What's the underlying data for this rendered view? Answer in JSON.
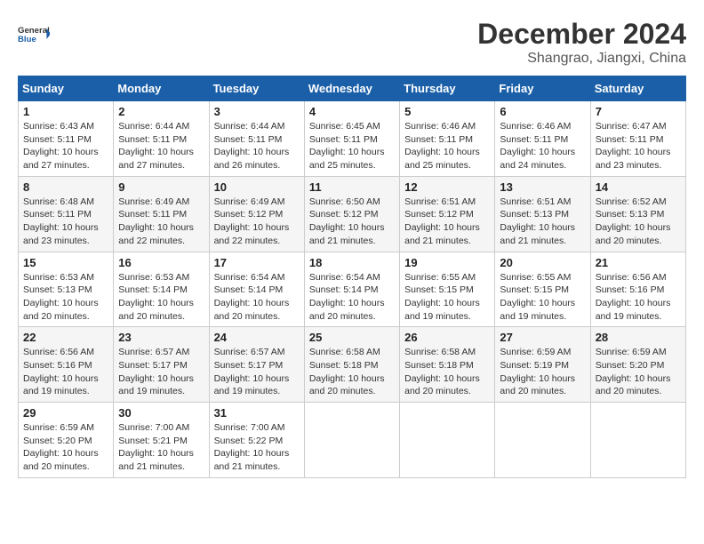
{
  "logo": {
    "line1": "General",
    "line2": "Blue"
  },
  "title": "December 2024",
  "location": "Shangrao, Jiangxi, China",
  "days_header": [
    "Sunday",
    "Monday",
    "Tuesday",
    "Wednesday",
    "Thursday",
    "Friday",
    "Saturday"
  ],
  "weeks": [
    [
      {
        "num": "1",
        "info": "Sunrise: 6:43 AM\nSunset: 5:11 PM\nDaylight: 10 hours\nand 27 minutes."
      },
      {
        "num": "2",
        "info": "Sunrise: 6:44 AM\nSunset: 5:11 PM\nDaylight: 10 hours\nand 27 minutes."
      },
      {
        "num": "3",
        "info": "Sunrise: 6:44 AM\nSunset: 5:11 PM\nDaylight: 10 hours\nand 26 minutes."
      },
      {
        "num": "4",
        "info": "Sunrise: 6:45 AM\nSunset: 5:11 PM\nDaylight: 10 hours\nand 25 minutes."
      },
      {
        "num": "5",
        "info": "Sunrise: 6:46 AM\nSunset: 5:11 PM\nDaylight: 10 hours\nand 25 minutes."
      },
      {
        "num": "6",
        "info": "Sunrise: 6:46 AM\nSunset: 5:11 PM\nDaylight: 10 hours\nand 24 minutes."
      },
      {
        "num": "7",
        "info": "Sunrise: 6:47 AM\nSunset: 5:11 PM\nDaylight: 10 hours\nand 23 minutes."
      }
    ],
    [
      {
        "num": "8",
        "info": "Sunrise: 6:48 AM\nSunset: 5:11 PM\nDaylight: 10 hours\nand 23 minutes."
      },
      {
        "num": "9",
        "info": "Sunrise: 6:49 AM\nSunset: 5:11 PM\nDaylight: 10 hours\nand 22 minutes."
      },
      {
        "num": "10",
        "info": "Sunrise: 6:49 AM\nSunset: 5:12 PM\nDaylight: 10 hours\nand 22 minutes."
      },
      {
        "num": "11",
        "info": "Sunrise: 6:50 AM\nSunset: 5:12 PM\nDaylight: 10 hours\nand 21 minutes."
      },
      {
        "num": "12",
        "info": "Sunrise: 6:51 AM\nSunset: 5:12 PM\nDaylight: 10 hours\nand 21 minutes."
      },
      {
        "num": "13",
        "info": "Sunrise: 6:51 AM\nSunset: 5:13 PM\nDaylight: 10 hours\nand 21 minutes."
      },
      {
        "num": "14",
        "info": "Sunrise: 6:52 AM\nSunset: 5:13 PM\nDaylight: 10 hours\nand 20 minutes."
      }
    ],
    [
      {
        "num": "15",
        "info": "Sunrise: 6:53 AM\nSunset: 5:13 PM\nDaylight: 10 hours\nand 20 minutes."
      },
      {
        "num": "16",
        "info": "Sunrise: 6:53 AM\nSunset: 5:14 PM\nDaylight: 10 hours\nand 20 minutes."
      },
      {
        "num": "17",
        "info": "Sunrise: 6:54 AM\nSunset: 5:14 PM\nDaylight: 10 hours\nand 20 minutes."
      },
      {
        "num": "18",
        "info": "Sunrise: 6:54 AM\nSunset: 5:14 PM\nDaylight: 10 hours\nand 20 minutes."
      },
      {
        "num": "19",
        "info": "Sunrise: 6:55 AM\nSunset: 5:15 PM\nDaylight: 10 hours\nand 19 minutes."
      },
      {
        "num": "20",
        "info": "Sunrise: 6:55 AM\nSunset: 5:15 PM\nDaylight: 10 hours\nand 19 minutes."
      },
      {
        "num": "21",
        "info": "Sunrise: 6:56 AM\nSunset: 5:16 PM\nDaylight: 10 hours\nand 19 minutes."
      }
    ],
    [
      {
        "num": "22",
        "info": "Sunrise: 6:56 AM\nSunset: 5:16 PM\nDaylight: 10 hours\nand 19 minutes."
      },
      {
        "num": "23",
        "info": "Sunrise: 6:57 AM\nSunset: 5:17 PM\nDaylight: 10 hours\nand 19 minutes."
      },
      {
        "num": "24",
        "info": "Sunrise: 6:57 AM\nSunset: 5:17 PM\nDaylight: 10 hours\nand 19 minutes."
      },
      {
        "num": "25",
        "info": "Sunrise: 6:58 AM\nSunset: 5:18 PM\nDaylight: 10 hours\nand 20 minutes."
      },
      {
        "num": "26",
        "info": "Sunrise: 6:58 AM\nSunset: 5:18 PM\nDaylight: 10 hours\nand 20 minutes."
      },
      {
        "num": "27",
        "info": "Sunrise: 6:59 AM\nSunset: 5:19 PM\nDaylight: 10 hours\nand 20 minutes."
      },
      {
        "num": "28",
        "info": "Sunrise: 6:59 AM\nSunset: 5:20 PM\nDaylight: 10 hours\nand 20 minutes."
      }
    ],
    [
      {
        "num": "29",
        "info": "Sunrise: 6:59 AM\nSunset: 5:20 PM\nDaylight: 10 hours\nand 20 minutes."
      },
      {
        "num": "30",
        "info": "Sunrise: 7:00 AM\nSunset: 5:21 PM\nDaylight: 10 hours\nand 21 minutes."
      },
      {
        "num": "31",
        "info": "Sunrise: 7:00 AM\nSunset: 5:22 PM\nDaylight: 10 hours\nand 21 minutes."
      },
      {
        "num": "",
        "info": ""
      },
      {
        "num": "",
        "info": ""
      },
      {
        "num": "",
        "info": ""
      },
      {
        "num": "",
        "info": ""
      }
    ]
  ]
}
